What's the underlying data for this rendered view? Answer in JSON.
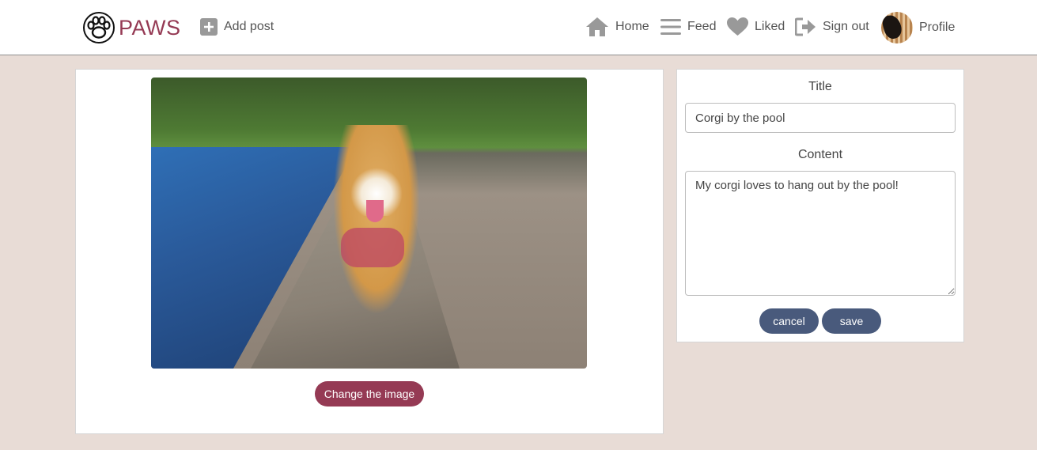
{
  "brand": {
    "name": "PAWS",
    "logo_icon": "paw-icon",
    "color": "#953a54"
  },
  "nav": {
    "add_post": "Add post",
    "home": "Home",
    "feed": "Feed",
    "liked": "Liked",
    "sign_out": "Sign out",
    "profile": "Profile"
  },
  "image_panel": {
    "image_alt": "Corgi walking on a stone ledge by the pool",
    "change_image_label": "Change the image",
    "accent_color": "#953a54"
  },
  "form": {
    "title_label": "Title",
    "title_value": "Corgi by the pool",
    "content_label": "Content",
    "content_value": "My corgi loves to hang out by the pool!",
    "cancel_label": "cancel",
    "save_label": "save",
    "button_color": "#495a7c"
  }
}
